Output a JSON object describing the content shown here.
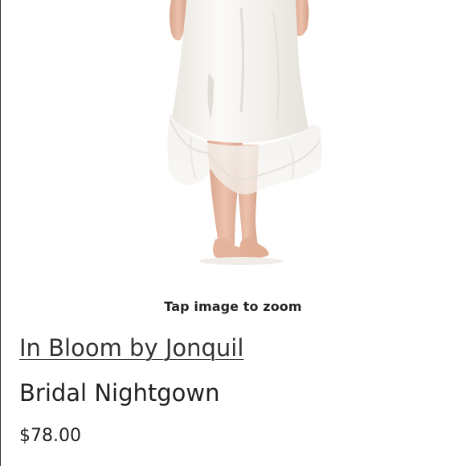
{
  "product": {
    "image_alt": "Model wearing white bridal nightgown",
    "zoom_hint": "Tap image to zoom",
    "brand": "In Bloom by Jonquil",
    "title": "Bridal Nightgown",
    "price": "$78.00"
  },
  "colors": {
    "text": "#222222",
    "brand_link": "#333333",
    "gown_fabric": "#f4f2ee",
    "skin": "#e9bba5",
    "left_rule": "#3a3a3a"
  }
}
